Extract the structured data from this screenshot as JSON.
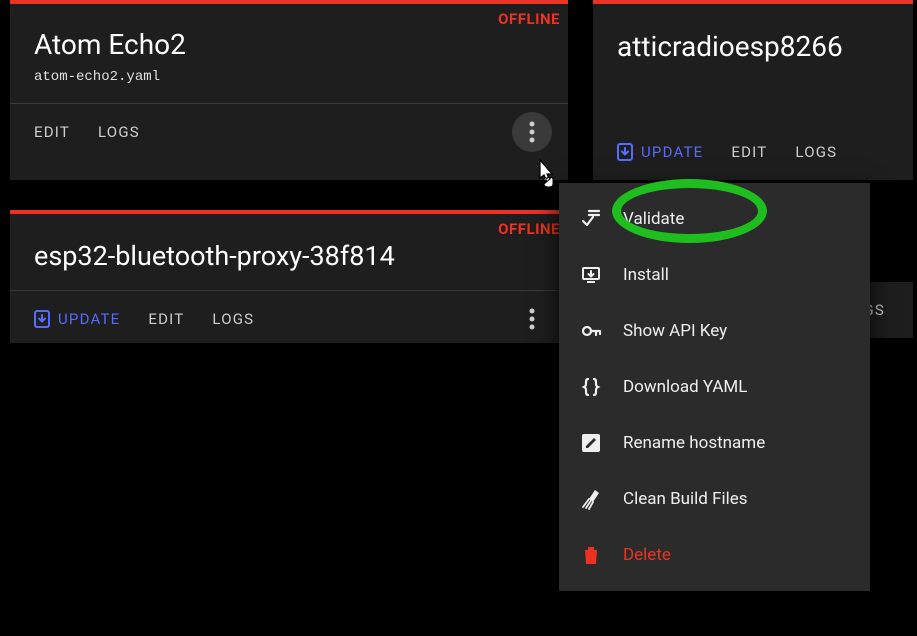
{
  "labels": {
    "offline": "OFFLINE",
    "edit": "EDIT",
    "logs": "LOGS",
    "update": "UPDATE"
  },
  "cards": {
    "a": {
      "title": "Atom Echo2",
      "sub": "atom-echo2.yaml"
    },
    "b": {
      "title": "esp32-bluetooth-proxy-38f814"
    },
    "c": {
      "title": "atticradioesp8266"
    }
  },
  "menu": {
    "validate": "Validate",
    "install": "Install",
    "show_api_key": "Show API Key",
    "download_yaml": "Download YAML",
    "rename_hostname": "Rename hostname",
    "clean_build": "Clean Build Files",
    "delete": "Delete"
  },
  "peek": {
    "logs_tail": "OGS"
  }
}
